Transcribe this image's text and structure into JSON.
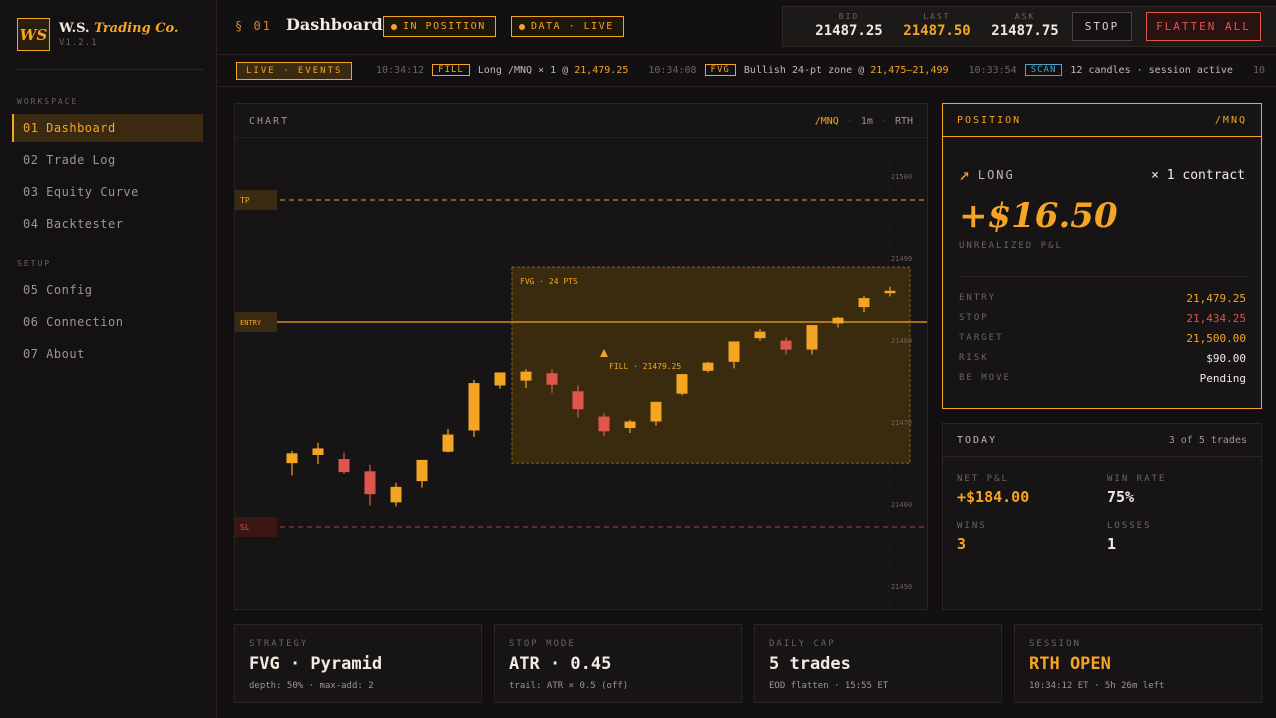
{
  "brand": {
    "logo": "WS",
    "name_main": "W.S.",
    "name_accent": "Trading Co.",
    "version": "V1.2.1"
  },
  "sidebar": {
    "sections": [
      {
        "label": "WORKSPACE",
        "items": [
          {
            "label": "01 Dashboard",
            "active": true
          },
          {
            "label": "02 Trade Log"
          },
          {
            "label": "03 Equity Curve"
          },
          {
            "label": "04 Backtester"
          }
        ]
      },
      {
        "label": "SETUP",
        "items": [
          {
            "label": "05 Config"
          },
          {
            "label": "06 Connection"
          },
          {
            "label": "07 About"
          }
        ]
      }
    ]
  },
  "header": {
    "section_num": "§ 01",
    "title": "Dashboard",
    "status_pills": [
      "IN POSITION",
      "DATA · LIVE"
    ],
    "quotes": [
      {
        "label": "BID",
        "value": "21487.25"
      },
      {
        "label": "LAST",
        "value": "21487.50"
      },
      {
        "label": "ASK",
        "value": "21487.75"
      }
    ],
    "stop_button": "STOP",
    "flatten_button": "FLATTEN ALL"
  },
  "ticker": {
    "label": "LIVE · EVENTS",
    "events": [
      {
        "time": "10:34:12",
        "tag": "FILL",
        "text": "Long /MNQ × 1 @ ",
        "highlight": "21,479.25"
      },
      {
        "time": "10:34:08",
        "tag": "FVG",
        "text": "Bullish 24-pt zone @ ",
        "highlight": "21,475–21,499"
      },
      {
        "time": "10:33:54",
        "tag": "SCAN",
        "text": "12 candles · session active",
        "highlight": ""
      },
      {
        "time": "10",
        "tag": "",
        "text": "",
        "highlight": ""
      }
    ]
  },
  "chart": {
    "title": "CHART",
    "symbol": "/MNQ",
    "timeframe": "1m",
    "session": "RTH",
    "zone_label": "FVG · 24 PTS",
    "fill_label": "FILL · 21479.25",
    "level_labels": {
      "tp": "TP",
      "entry": "ENTRY",
      "sl": "SL"
    }
  },
  "chart_data": {
    "type": "candlestick",
    "y_ticks": [
      21500,
      21490,
      21480,
      21470,
      21460,
      21450
    ],
    "ylim": [
      21448,
      21504
    ],
    "candles": [
      {
        "o": 21475.0,
        "h": 21476.5,
        "l": 21473.5,
        "c": 21476.2
      },
      {
        "o": 21476.0,
        "h": 21477.5,
        "l": 21474.9,
        "c": 21476.8
      },
      {
        "o": 21475.5,
        "h": 21476.3,
        "l": 21473.7,
        "c": 21473.9
      },
      {
        "o": 21474.0,
        "h": 21474.8,
        "l": 21469.8,
        "c": 21471.2
      },
      {
        "o": 21470.2,
        "h": 21472.6,
        "l": 21469.7,
        "c": 21472.1
      },
      {
        "o": 21472.8,
        "h": 21475.3,
        "l": 21472.0,
        "c": 21475.4
      },
      {
        "o": 21476.4,
        "h": 21479.2,
        "l": 21476.3,
        "c": 21478.5
      },
      {
        "o": 21479.0,
        "h": 21485.2,
        "l": 21478.2,
        "c": 21484.8
      },
      {
        "o": 21484.5,
        "h": 21486.0,
        "l": 21484.1,
        "c": 21486.1
      },
      {
        "o": 21485.1,
        "h": 21486.5,
        "l": 21484.2,
        "c": 21486.2
      },
      {
        "o": 21486.0,
        "h": 21486.5,
        "l": 21483.6,
        "c": 21484.6
      },
      {
        "o": 21483.8,
        "h": 21484.5,
        "l": 21480.6,
        "c": 21481.6
      },
      {
        "o": 21480.7,
        "h": 21481.1,
        "l": 21478.3,
        "c": 21478.9
      },
      {
        "o": 21479.3,
        "h": 21480.3,
        "l": 21478.7,
        "c": 21480.1
      },
      {
        "o": 21480.1,
        "h": 21482.5,
        "l": 21479.6,
        "c": 21482.5
      },
      {
        "o": 21483.5,
        "h": 21485.9,
        "l": 21483.3,
        "c": 21485.9
      },
      {
        "o": 21486.3,
        "h": 21487.4,
        "l": 21486.1,
        "c": 21487.3
      },
      {
        "o": 21487.4,
        "h": 21489.6,
        "l": 21486.6,
        "c": 21489.9
      },
      {
        "o": 21490.3,
        "h": 21491.4,
        "l": 21490.0,
        "c": 21491.1
      },
      {
        "o": 21490.0,
        "h": 21490.4,
        "l": 21488.3,
        "c": 21488.9
      },
      {
        "o": 21488.9,
        "h": 21491.9,
        "l": 21488.3,
        "c": 21491.9
      },
      {
        "o": 21492.1,
        "h": 21492.9,
        "l": 21491.6,
        "c": 21492.8
      },
      {
        "o": 21494.1,
        "h": 21495.5,
        "l": 21493.5,
        "c": 21495.2
      },
      {
        "o": 21495.8,
        "h": 21496.6,
        "l": 21495.4,
        "c": 21496.1
      }
    ],
    "levels": {
      "tp": 21500.0,
      "entry": 21479.25,
      "sl": 21434.25
    },
    "fvg_zone": [
      21475,
      21499
    ],
    "fill": 21479.25,
    "grid": false
  },
  "position": {
    "title": "POSITION",
    "symbol": "/MNQ",
    "direction": "LONG",
    "quantity": "× 1 contract",
    "pnl": "+$16.50",
    "pnl_label": "UNREALIZED P&L",
    "rows": [
      {
        "key": "ENTRY",
        "value": "21,479.25",
        "tone": "amber"
      },
      {
        "key": "STOP",
        "value": "21,434.25",
        "tone": "red"
      },
      {
        "key": "TARGET",
        "value": "21,500.00",
        "tone": "amber"
      },
      {
        "key": "RISK",
        "value": "$90.00",
        "tone": ""
      },
      {
        "key": "BE MOVE",
        "value": "Pending",
        "tone": ""
      }
    ]
  },
  "today": {
    "title": "TODAY",
    "count": "3 of 5 trades",
    "stats": [
      {
        "key": "NET P&L",
        "value": "+$184.00",
        "tone": "amber"
      },
      {
        "key": "WIN RATE",
        "value": "75%",
        "tone": ""
      },
      {
        "key": "WINS",
        "value": "3",
        "tone": "amber"
      },
      {
        "key": "LOSSES",
        "value": "1",
        "tone": ""
      }
    ]
  },
  "cards": [
    {
      "key": "STRATEGY",
      "value": "FVG · Pyramid",
      "sub": "depth: 50% · max-add: 2",
      "tone": ""
    },
    {
      "key": "STOP MODE",
      "value": "ATR · 0.45",
      "sub": "trail: ATR × 0.5 (off)",
      "tone": ""
    },
    {
      "key": "DAILY CAP",
      "value": "5 trades",
      "sub": "EOD flatten · 15:55 ET",
      "tone": ""
    },
    {
      "key": "SESSION",
      "value": "RTH OPEN",
      "sub": "10:34:12 ET · 5h 26m left",
      "tone": "amber"
    }
  ],
  "colors": {
    "accent": "#f5a524",
    "danger": "#e0564a",
    "bg": "#121011",
    "panel": "#161415"
  }
}
